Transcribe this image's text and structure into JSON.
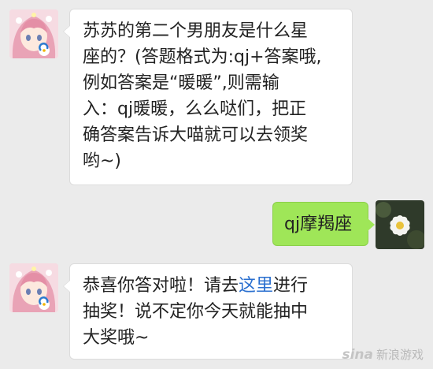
{
  "messages": [
    {
      "side": "left",
      "lines": [
        "苏苏的第二个男朋友是什么星",
        "座的？(答题格式为:qj+答案哦,",
        "例如答案是“暖暖”,则需输",
        "入：qj暖暖，么么哒们，把正",
        "确答案告诉大喵就可以去领奖",
        "哟~)"
      ]
    },
    {
      "side": "right",
      "text": "qj摩羯座"
    },
    {
      "side": "left",
      "line1_before": "恭喜你答对啦！请去",
      "line1_link": "这里",
      "line1_after": "进行",
      "line2": "抽奖！说不定你今天就能抽中",
      "line3": "大奖哦~"
    }
  ],
  "icons": {
    "bot_avatar": "anime-girl-avatar",
    "user_avatar": "white-flower-avatar",
    "badge": "tencent-games-logo"
  },
  "watermark": {
    "logo": "sina",
    "text": "新浪游戏"
  },
  "colors": {
    "background": "#ebebeb",
    "sent_bubble": "#9fe658",
    "received_bubble": "#ffffff",
    "link": "#2a6fcf"
  }
}
